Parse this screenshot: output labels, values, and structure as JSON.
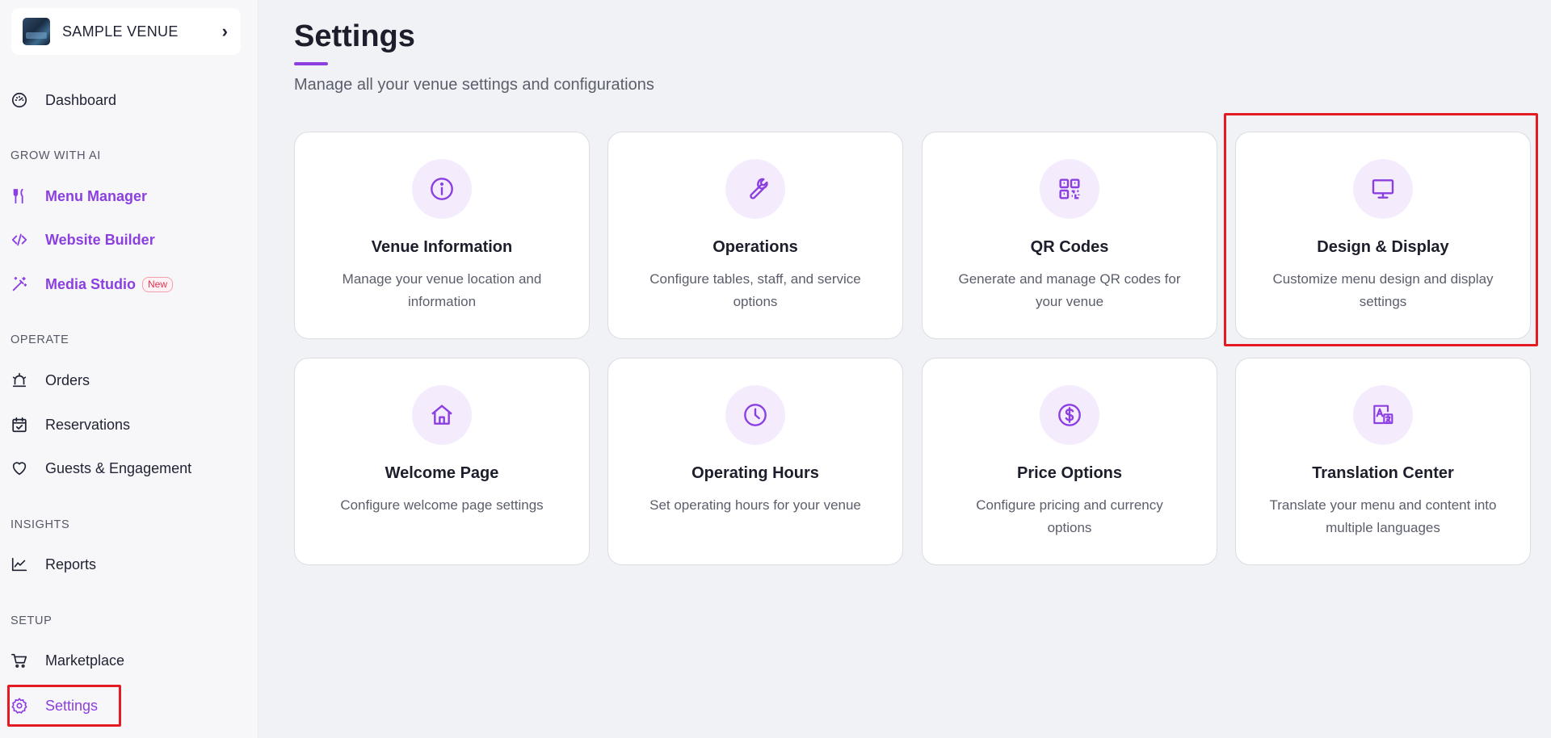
{
  "venue": {
    "name": "SAMPLE VENUE"
  },
  "sidebar": {
    "dashboard": "Dashboard",
    "grow_label": "GROW WITH AI",
    "menu_manager": "Menu Manager",
    "website_builder": "Website Builder",
    "media_studio": "Media Studio",
    "new_badge": "New",
    "operate_label": "OPERATE",
    "orders": "Orders",
    "reservations": "Reservations",
    "guests": "Guests & Engagement",
    "insights_label": "INSIGHTS",
    "reports": "Reports",
    "setup_label": "SETUP",
    "marketplace": "Marketplace",
    "settings": "Settings"
  },
  "main": {
    "title": "Settings",
    "subtitle": "Manage all your venue settings and configurations",
    "cards": [
      {
        "title": "Venue Information",
        "desc": "Manage your venue location and information",
        "icon": "info-icon"
      },
      {
        "title": "Operations",
        "desc": "Configure tables, staff, and service options",
        "icon": "wrench-icon"
      },
      {
        "title": "QR Codes",
        "desc": "Generate and manage QR codes for your venue",
        "icon": "qr-code-icon"
      },
      {
        "title": "Design & Display",
        "desc": "Customize menu design and display settings",
        "icon": "monitor-icon"
      },
      {
        "title": "Welcome Page",
        "desc": "Configure welcome page settings",
        "icon": "home-icon"
      },
      {
        "title": "Operating Hours",
        "desc": "Set operating hours for your venue",
        "icon": "clock-icon"
      },
      {
        "title": "Price Options",
        "desc": "Configure pricing and currency options",
        "icon": "dollar-icon"
      },
      {
        "title": "Translation Center",
        "desc": "Translate your menu and content into multiple languages",
        "icon": "translate-icon"
      }
    ]
  },
  "colors": {
    "accent": "#8b3fe0",
    "highlight": "#e41b23",
    "icon_bg": "#f4ecfd"
  }
}
